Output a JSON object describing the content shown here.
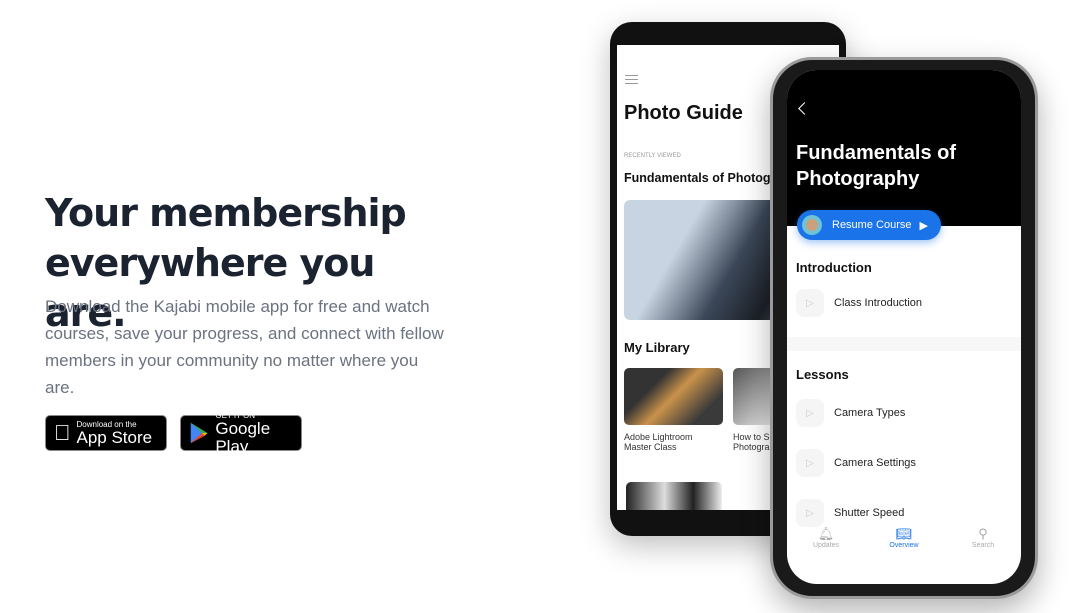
{
  "hero": {
    "title": "Your membership everywhere you are.",
    "text": "Download the Kajabi mobile app for free and watch courses, save your progress, and connect with fellow members in your community no matter where you are."
  },
  "badges": {
    "appstore": {
      "small": "Download on the",
      "big": "App Store"
    },
    "googleplay": {
      "small": "GET IT ON",
      "big": "Google Play"
    }
  },
  "android": {
    "title": "Photo Guide",
    "recent_label": "RECENTLY VIEWED",
    "recent_course": "Fundamentals of Photography",
    "library_title": "My Library",
    "library": [
      {
        "line1": "Adobe Lightroom",
        "line2": "Master Class"
      },
      {
        "line1": "How to S",
        "line2": "Photogra"
      }
    ]
  },
  "iphone": {
    "title": "Fundamentals of Photography",
    "resume": "Resume Course",
    "sections": [
      {
        "title": "Introduction",
        "lessons": [
          "Class Introduction"
        ]
      },
      {
        "title": "Lessons",
        "lessons": [
          "Camera Types",
          "Camera Settings",
          "Shutter Speed"
        ]
      }
    ],
    "tabs": [
      "Updates",
      "Overview",
      "Search"
    ],
    "accent": "#1a73e8"
  }
}
